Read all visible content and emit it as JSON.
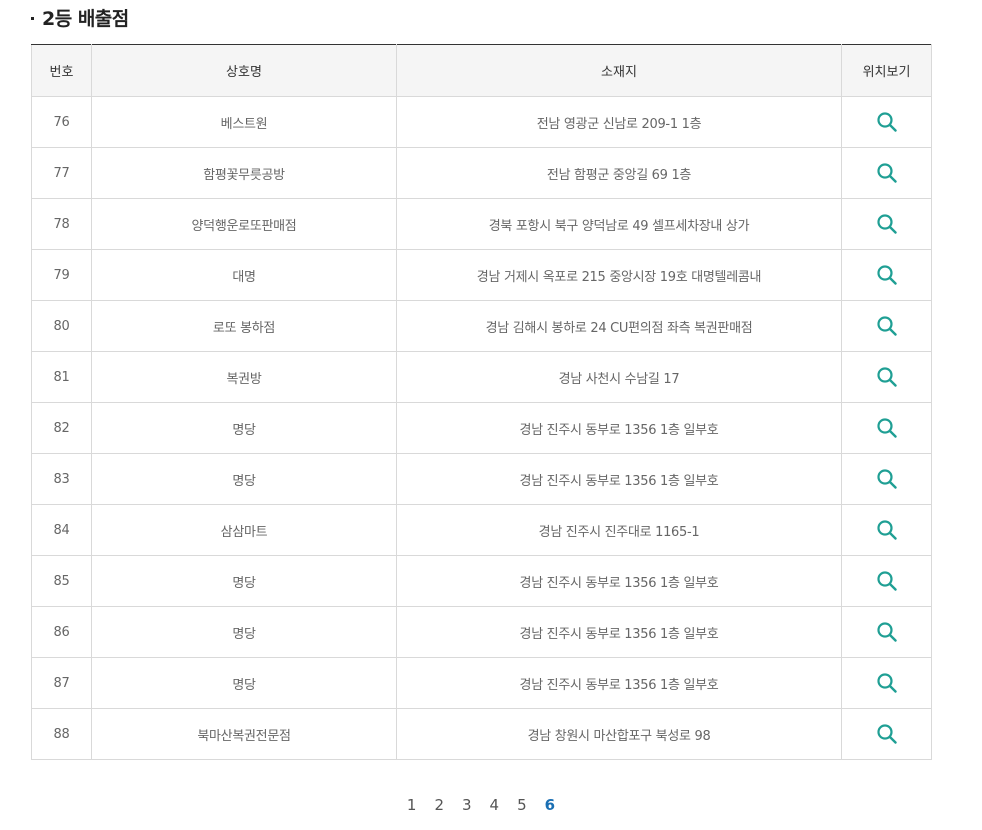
{
  "section": {
    "title": "2등 배출점"
  },
  "table": {
    "headers": [
      "번호",
      "상호명",
      "소재지",
      "위치보기"
    ],
    "rows": [
      {
        "no": "76",
        "name": "베스트원",
        "address": "전남 영광군 신남로 209-1 1층"
      },
      {
        "no": "77",
        "name": "함평꽃무릇공방",
        "address": "전남 함평군 중앙길 69 1층"
      },
      {
        "no": "78",
        "name": "양덕행운로또판매점",
        "address": "경북 포항시 북구 양덕남로 49 셀프세차장내 상가"
      },
      {
        "no": "79",
        "name": "대명",
        "address": "경남 거제시 옥포로 215 중앙시장 19호 대명텔레콤내"
      },
      {
        "no": "80",
        "name": "로또 봉하점",
        "address": "경남 김해시 봉하로 24 CU편의점 좌측 복권판매점"
      },
      {
        "no": "81",
        "name": "복권방",
        "address": "경남 사천시 수남길 17"
      },
      {
        "no": "82",
        "name": "명당",
        "address": "경남 진주시 동부로 1356 1층 일부호"
      },
      {
        "no": "83",
        "name": "명당",
        "address": "경남 진주시 동부로 1356 1층 일부호"
      },
      {
        "no": "84",
        "name": "삼삼마트",
        "address": "경남 진주시 진주대로 1165-1"
      },
      {
        "no": "85",
        "name": "명당",
        "address": "경남 진주시 동부로 1356 1층 일부호"
      },
      {
        "no": "86",
        "name": "명당",
        "address": "경남 진주시 동부로 1356 1층 일부호"
      },
      {
        "no": "87",
        "name": "명당",
        "address": "경남 진주시 동부로 1356 1층 일부호"
      },
      {
        "no": "88",
        "name": "북마산복권전문점",
        "address": "경남 창원시 마산합포구 북성로 98"
      }
    ],
    "location_icon": "search-icon",
    "icon_color": "#1f9f94"
  },
  "pagination": {
    "pages": [
      "1",
      "2",
      "3",
      "4",
      "5",
      "6"
    ],
    "current": "6"
  }
}
